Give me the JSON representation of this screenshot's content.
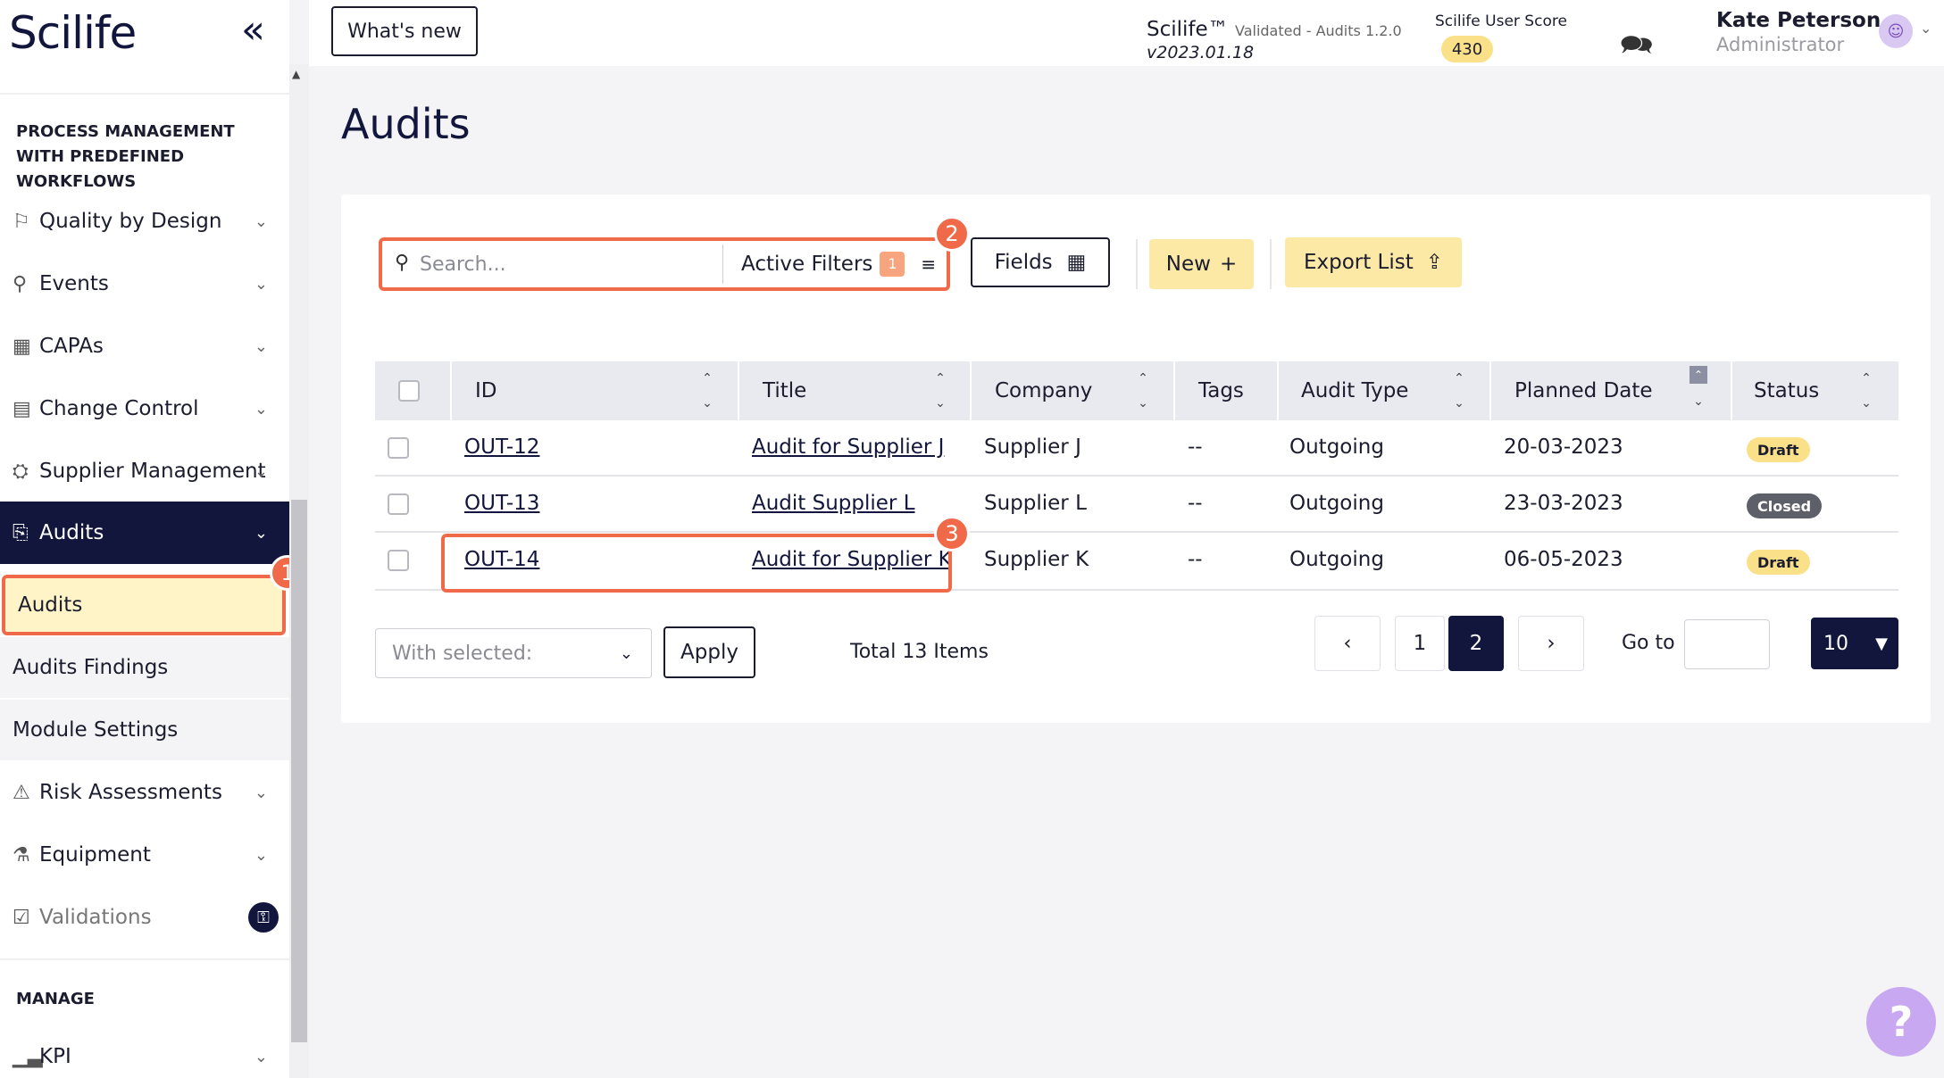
{
  "app": {
    "logo": "Scilife",
    "collapse_icon": "double-chevron-left-icon"
  },
  "header": {
    "whats_new": "What's new",
    "brand": "Scilife™",
    "brand_sub": "Validated - Audits 1.2.0",
    "version": "v2023.01.18",
    "score_label": "Scilife User Score",
    "score": "430",
    "user_name": "Kate Peterson",
    "user_role": "Administrator"
  },
  "sidebar": {
    "section_process": "PROCESS MANAGEMENT WITH PREDEFINED WORKFLOWS",
    "items": [
      {
        "label": "Quality by Design",
        "icon": "signpost-icon"
      },
      {
        "label": "Events",
        "icon": "pin-icon"
      },
      {
        "label": "CAPAs",
        "icon": "chart-icon"
      },
      {
        "label": "Change Control",
        "icon": "document-icon"
      },
      {
        "label": "Supplier Management",
        "icon": "handshake-icon"
      },
      {
        "label": "Audits",
        "icon": "audit-icon"
      }
    ],
    "sub_items": [
      "Audits",
      "Audits Findings",
      "Module Settings"
    ],
    "items2": [
      {
        "label": "Risk Assessments",
        "icon": "warning-icon"
      },
      {
        "label": "Equipment",
        "icon": "flask-icon"
      },
      {
        "label": "Validations",
        "icon": "clipboard-icon"
      }
    ],
    "section_manage": "MANAGE",
    "kpi": "KPI"
  },
  "main": {
    "title": "Audits",
    "search_placeholder": "Search...",
    "active_filters": "Active Filters",
    "filter_count": "1",
    "fields": "Fields",
    "new": "New",
    "export": "Export List",
    "columns": [
      "ID",
      "Title",
      "Company",
      "Tags",
      "Audit Type",
      "Planned Date",
      "Status"
    ],
    "rows": [
      {
        "id": "OUT-12",
        "title": "Audit for Supplier J",
        "company": "Supplier J",
        "tags": "--",
        "type": "Outgoing",
        "date": "20-03-2023",
        "status": "Draft"
      },
      {
        "id": "OUT-13",
        "title": "Audit Supplier L",
        "company": "Supplier L",
        "tags": "--",
        "type": "Outgoing",
        "date": "23-03-2023",
        "status": "Closed"
      },
      {
        "id": "OUT-14",
        "title": "Audit for Supplier K",
        "company": "Supplier K",
        "tags": "--",
        "type": "Outgoing",
        "date": "06-05-2023",
        "status": "Draft"
      }
    ],
    "with_selected": "With selected:",
    "apply": "Apply",
    "total": "Total 13 Items",
    "pages": [
      "1",
      "2"
    ],
    "current_page": "2",
    "goto": "Go to",
    "per_page": "10"
  },
  "callouts": [
    "1",
    "2",
    "3"
  ],
  "colors": {
    "accent": "#f06a4a",
    "navy": "#12163c",
    "yellow": "#fce9a6"
  }
}
